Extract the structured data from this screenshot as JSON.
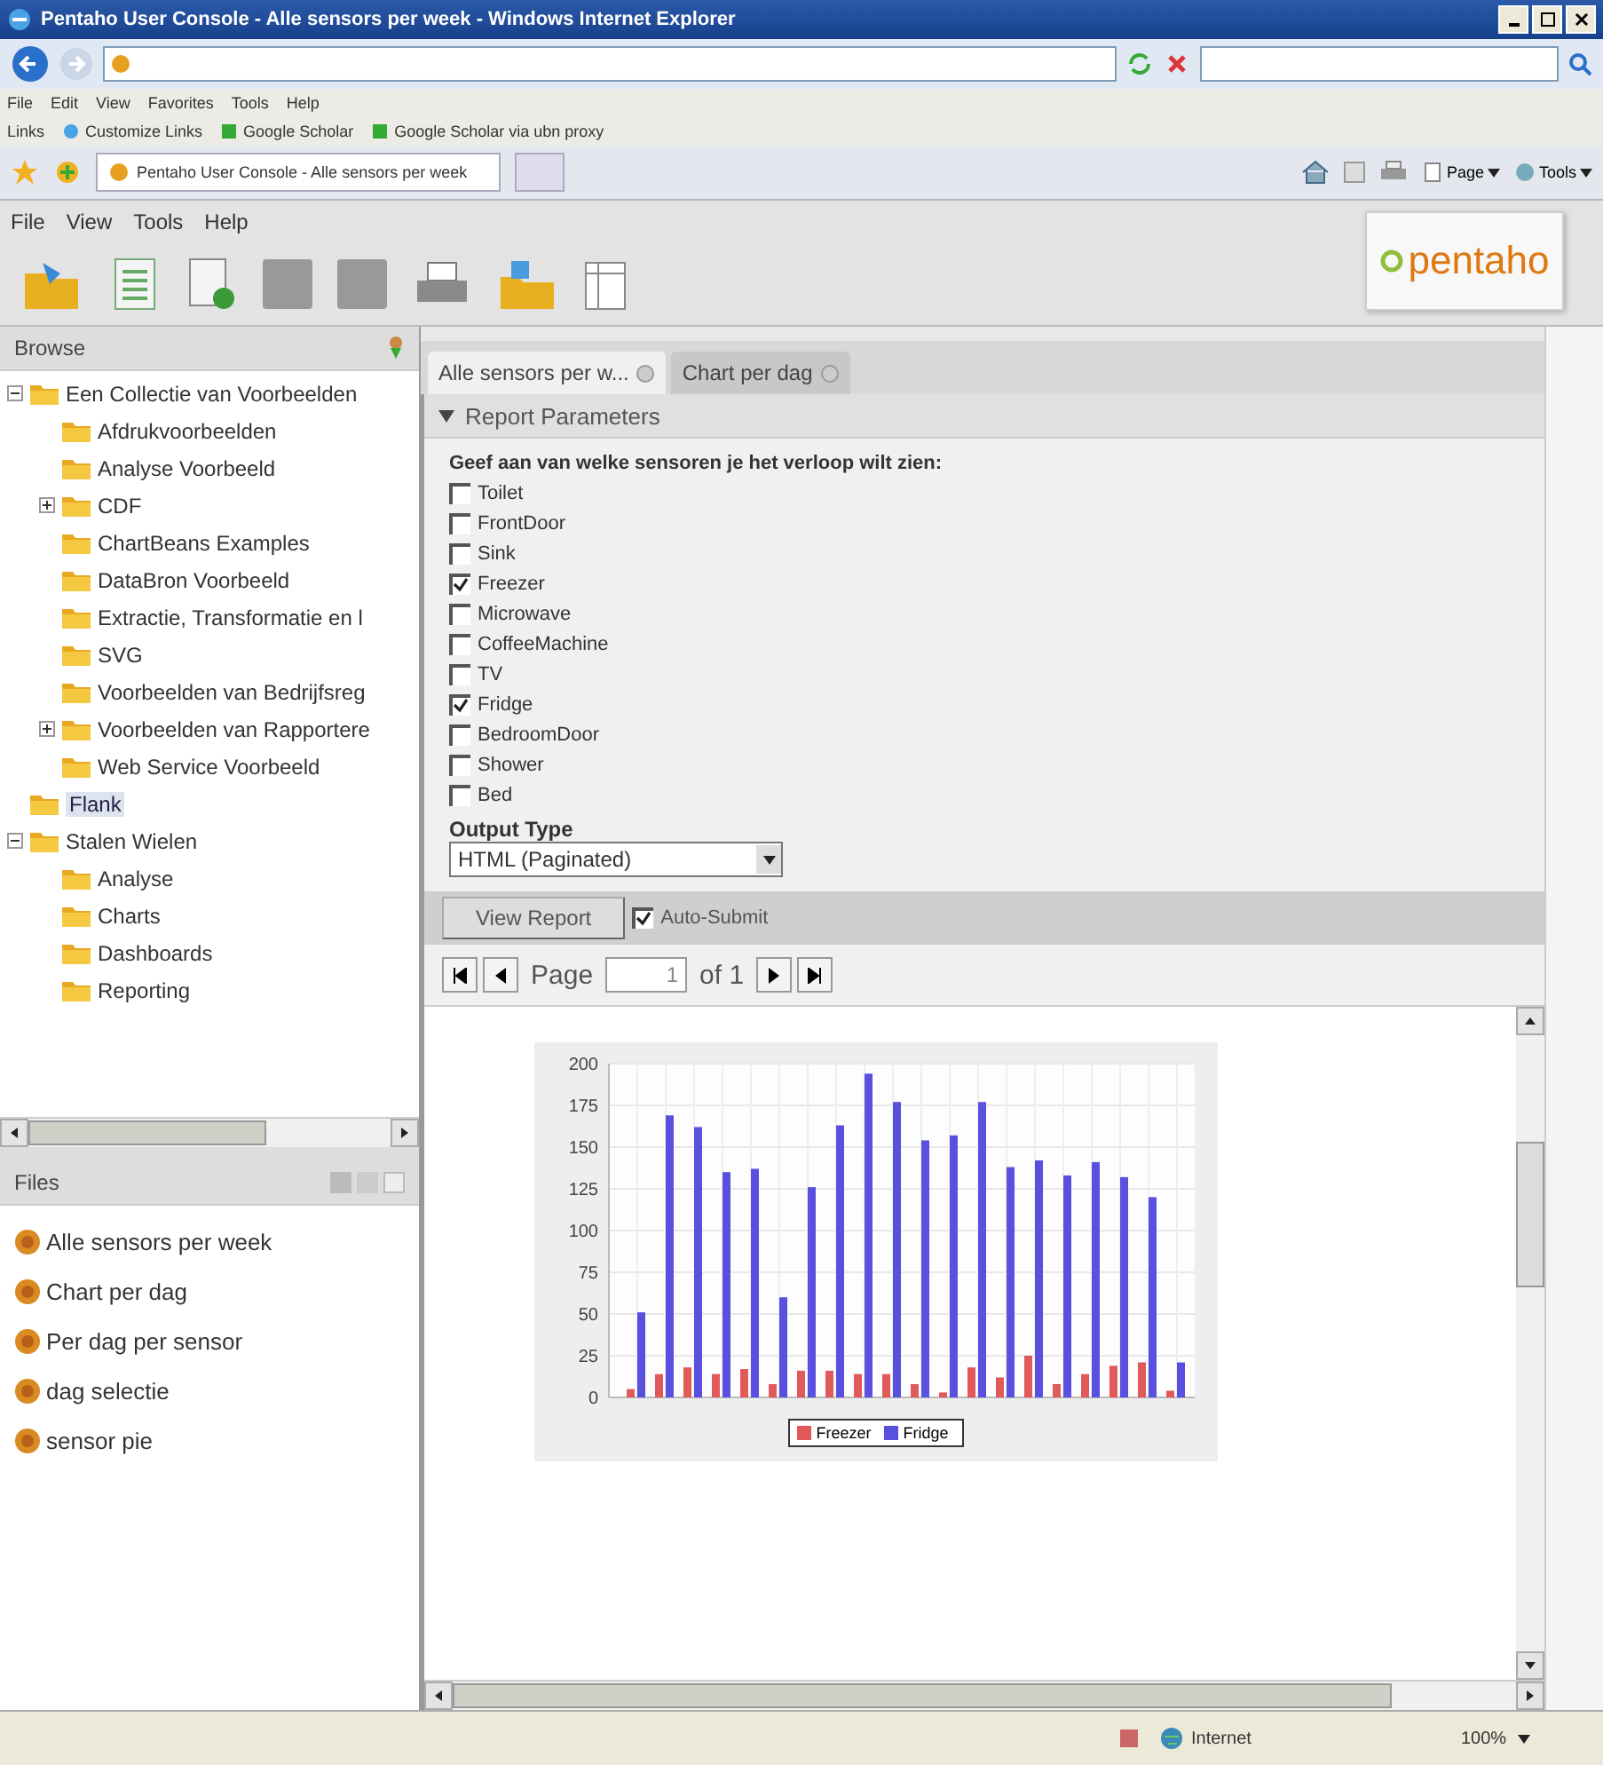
{
  "window": {
    "title": "Pentaho User Console - Alle sensors per week - Windows Internet Explorer"
  },
  "browser": {
    "menu": [
      "File",
      "Edit",
      "View",
      "Favorites",
      "Tools",
      "Help"
    ],
    "links_label": "Links",
    "links": [
      "Customize Links",
      "Google Scholar",
      "Google Scholar via ubn proxy"
    ],
    "tab_title": "Pentaho User Console - Alle sensors per week",
    "commands": [
      "Page",
      "Tools"
    ]
  },
  "app": {
    "menu": [
      "File",
      "View",
      "Tools",
      "Help"
    ],
    "logo": "pentaho"
  },
  "browse": {
    "title": "Browse",
    "tree": [
      {
        "label": "Een Collectie van Voorbeelden",
        "expanded": true,
        "selected": false,
        "children": [
          {
            "label": "Afdrukvoorbeelden",
            "selected": false
          },
          {
            "label": "Analyse Voorbeeld",
            "selected": false
          },
          {
            "label": "CDF",
            "expanded": false,
            "selected": false
          },
          {
            "label": "ChartBeans Examples",
            "selected": false
          },
          {
            "label": "DataBron Voorbeeld",
            "selected": false
          },
          {
            "label": "Extractie, Transformatie en l",
            "selected": false
          },
          {
            "label": "SVG",
            "selected": false
          },
          {
            "label": "Voorbeelden van Bedrijfsreg",
            "selected": false
          },
          {
            "label": "Voorbeelden van Rapportere",
            "expanded": false,
            "selected": false
          },
          {
            "label": "Web Service Voorbeeld",
            "selected": false
          }
        ]
      },
      {
        "label": "Flank",
        "selected": true
      },
      {
        "label": "Stalen Wielen",
        "expanded": true,
        "selected": false,
        "children": [
          {
            "label": "Analyse",
            "selected": false
          },
          {
            "label": "Charts",
            "selected": false
          },
          {
            "label": "Dashboards",
            "selected": false
          },
          {
            "label": "Reporting",
            "selected": false
          }
        ]
      }
    ]
  },
  "files": {
    "title": "Files",
    "items": [
      "Alle sensors per week",
      "Chart per dag",
      "Per dag per sensor",
      "dag selectie",
      "sensor pie"
    ]
  },
  "tabs": [
    {
      "label": "Alle sensors per w...",
      "selected": true
    },
    {
      "label": "Chart per dag",
      "selected": false
    }
  ],
  "parameters": {
    "title": "Report Parameters",
    "expanded": true,
    "prompt": "Geef aan van welke sensoren je het verloop wilt zien:",
    "sensors": [
      {
        "label": "Toilet",
        "checked": false
      },
      {
        "label": "FrontDoor",
        "checked": false
      },
      {
        "label": "Sink",
        "checked": false
      },
      {
        "label": "Freezer",
        "checked": true
      },
      {
        "label": "Microwave",
        "checked": false
      },
      {
        "label": "CoffeeMachine",
        "checked": false
      },
      {
        "label": "TV",
        "checked": false
      },
      {
        "label": "Fridge",
        "checked": true
      },
      {
        "label": "BedroomDoor",
        "checked": false
      },
      {
        "label": "Shower",
        "checked": false
      },
      {
        "label": "Bed",
        "checked": false
      }
    ],
    "output_label": "Output Type",
    "output_value": "HTML (Paginated)",
    "view_report": "View Report",
    "auto_submit": {
      "label": "Auto-Submit",
      "checked": true
    }
  },
  "pager": {
    "label": "Page",
    "value": "1",
    "total": "of 1"
  },
  "report": {
    "chart_data": {
      "type": "bar",
      "grid": true,
      "legend": "bottom",
      "ylim": [
        0,
        200
      ],
      "yticks": [
        0,
        25,
        50,
        75,
        100,
        125,
        150,
        175,
        200
      ],
      "series": [
        {
          "name": "Freezer",
          "color": "#e05a5a",
          "values": [
            5,
            14,
            18,
            14,
            17,
            8,
            16,
            16,
            14,
            14,
            8,
            3,
            18,
            12,
            25,
            8,
            14,
            19,
            21,
            4
          ]
        },
        {
          "name": "Fridge",
          "color": "#5a50e0",
          "values": [
            51,
            169,
            162,
            135,
            137,
            60,
            126,
            163,
            194,
            177,
            154,
            157,
            177,
            138,
            142,
            133,
            141,
            132,
            120,
            21
          ]
        }
      ]
    }
  },
  "status_bar": {
    "zone": "Internet",
    "zoom": "100%"
  }
}
